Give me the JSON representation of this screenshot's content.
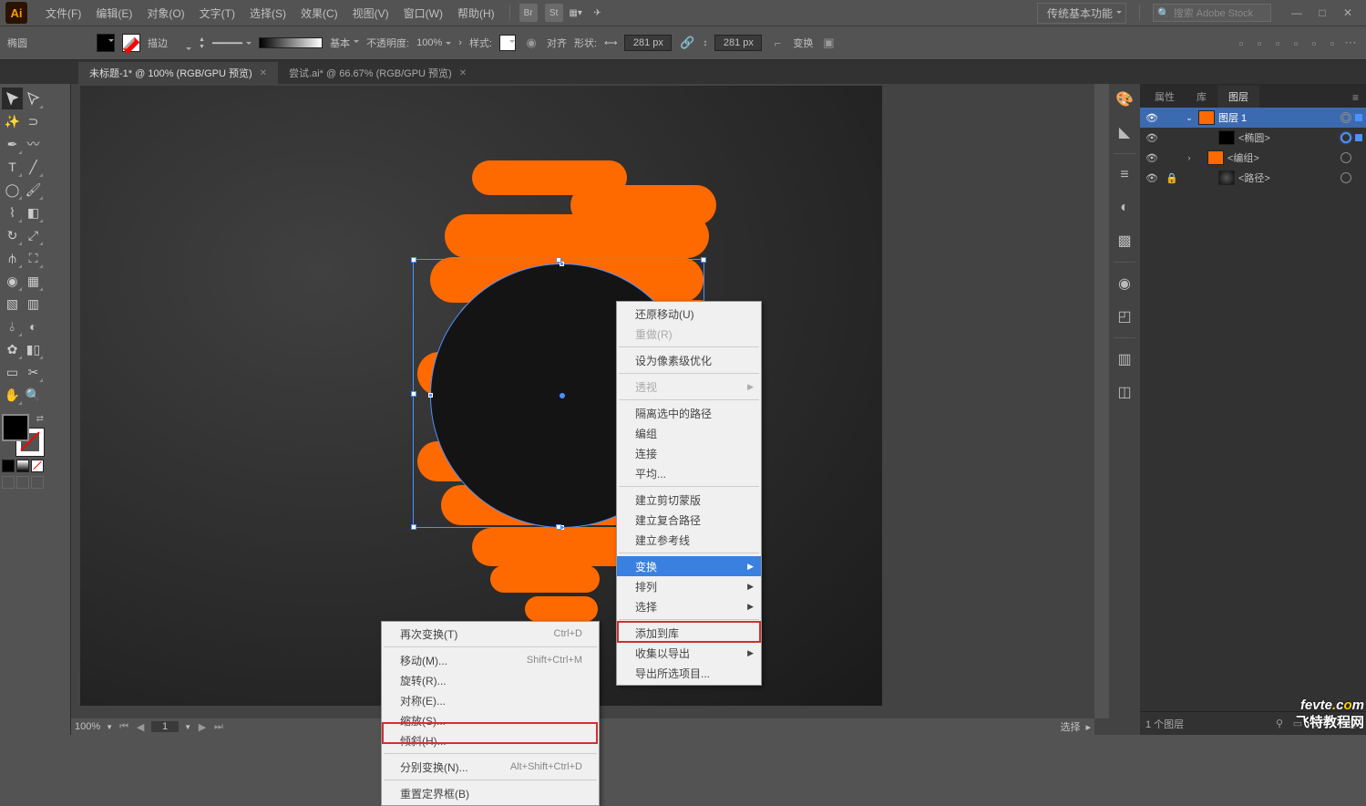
{
  "menubar": {
    "items": [
      "文件(F)",
      "编辑(E)",
      "对象(O)",
      "文字(T)",
      "选择(S)",
      "效果(C)",
      "视图(V)",
      "窗口(W)",
      "帮助(H)"
    ],
    "workspace": "传统基本功能",
    "search_placeholder": "搜索 Adobe Stock"
  },
  "controlbar": {
    "shape_label": "椭圆",
    "stroke_label": "描边",
    "stroke_dd": "",
    "style_dd": "基本",
    "opacity_label": "不透明度:",
    "opacity_val": "100%",
    "graphic_style_label": "样式:",
    "align_label": "对齐",
    "shape_btn": "形状:",
    "w_val": "281 px",
    "h_val": "281 px",
    "transform_label": "变换"
  },
  "tabs": [
    {
      "label": "未标题-1* @ 100% (RGB/GPU 预览)",
      "active": true
    },
    {
      "label": "尝试.ai* @ 66.67% (RGB/GPU 预览)",
      "active": false
    }
  ],
  "status": {
    "zoom": "100%",
    "page": "1",
    "mode": "选择"
  },
  "panel": {
    "tabs": [
      "属性",
      "库",
      "图层"
    ],
    "active_tab": 2,
    "layers": [
      {
        "name": "图层 1",
        "indent": 0,
        "sel": true,
        "thumb": "orange",
        "eye": true,
        "expand": "open",
        "target": "ring"
      },
      {
        "name": "<椭圆>",
        "indent": 1,
        "sel": false,
        "thumb": "black",
        "eye": true,
        "target": "filled",
        "selsq": true
      },
      {
        "name": "<编组>",
        "indent": 1,
        "sel": false,
        "thumb": "orange",
        "eye": true,
        "expand": "closed",
        "target": "ring"
      },
      {
        "name": "<路径>",
        "indent": 1,
        "sel": false,
        "thumb": "grad",
        "eye": true,
        "lock": true,
        "target": "ring"
      }
    ],
    "footer_count": "1 个图层"
  },
  "context_main": {
    "items": [
      {
        "label": "还原移动(U)"
      },
      {
        "label": "重做(R)",
        "disabled": true
      },
      {
        "sep": true
      },
      {
        "label": "设为像素级优化"
      },
      {
        "sep": true
      },
      {
        "label": "透视",
        "sub": true,
        "disabled": true
      },
      {
        "sep": true
      },
      {
        "label": "隔离选中的路径"
      },
      {
        "label": "编组"
      },
      {
        "label": "连接"
      },
      {
        "label": "平均..."
      },
      {
        "sep": true
      },
      {
        "label": "建立剪切蒙版"
      },
      {
        "label": "建立复合路径"
      },
      {
        "label": "建立参考线"
      },
      {
        "sep": true
      },
      {
        "label": "变换",
        "sub": true,
        "hl": true
      },
      {
        "label": "排列",
        "sub": true
      },
      {
        "label": "选择",
        "sub": true
      },
      {
        "sep": true
      },
      {
        "label": "添加到库"
      },
      {
        "label": "收集以导出",
        "sub": true
      },
      {
        "label": "导出所选项目..."
      }
    ]
  },
  "context_sub": {
    "items": [
      {
        "label": "再次变换(T)",
        "shortcut": "Ctrl+D"
      },
      {
        "sep": true
      },
      {
        "label": "移动(M)...",
        "shortcut": "Shift+Ctrl+M"
      },
      {
        "label": "旋转(R)..."
      },
      {
        "label": "对称(E)..."
      },
      {
        "label": "缩放(S)..."
      },
      {
        "label": "倾斜(H)..."
      },
      {
        "sep": true
      },
      {
        "label": "分别变换(N)...",
        "shortcut": "Alt+Shift+Ctrl+D"
      },
      {
        "sep": true
      },
      {
        "label": "重置定界框(B)"
      }
    ]
  },
  "watermark": {
    "text": "fevte.com",
    "cn": "飞特教程网"
  }
}
